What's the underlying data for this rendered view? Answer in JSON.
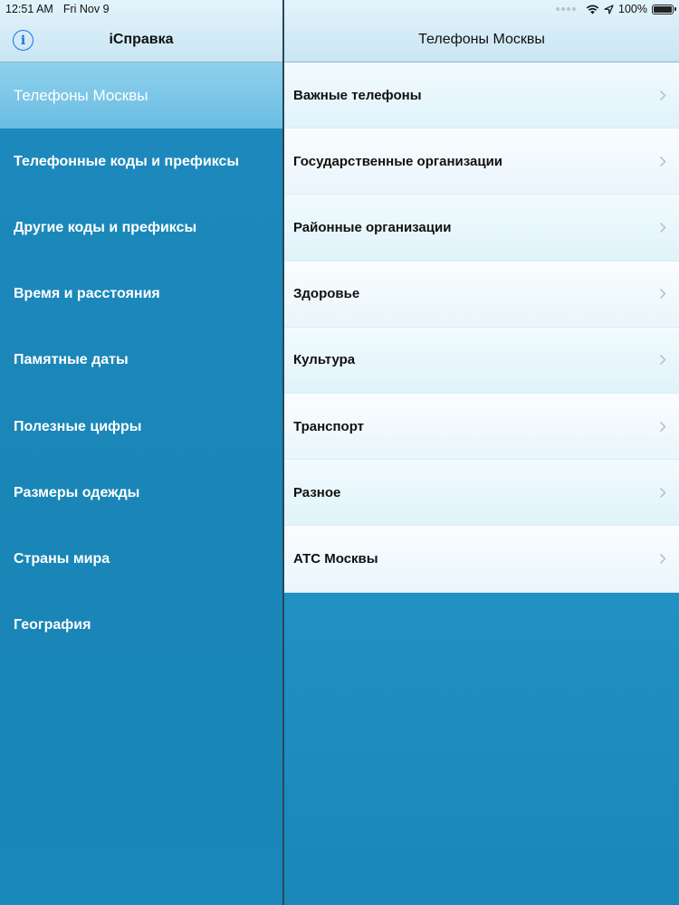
{
  "status": {
    "time": "12:51 AM",
    "date": "Fri Nov 9",
    "battery": "100%",
    "battery_level": 1.0
  },
  "sidebar": {
    "title": "iСправка",
    "items": [
      {
        "label": "Телефоны Москвы",
        "selected": true
      },
      {
        "label": "Телефонные коды и префиксы"
      },
      {
        "label": "Другие коды и префиксы"
      },
      {
        "label": "Время и расстояния"
      },
      {
        "label": "Памятные даты"
      },
      {
        "label": "Полезные цифры"
      },
      {
        "label": "Размеры одежды"
      },
      {
        "label": "Страны мира"
      },
      {
        "label": "География"
      }
    ]
  },
  "detail": {
    "title": "Телефоны Москвы",
    "items": [
      {
        "label": "Важные телефоны"
      },
      {
        "label": "Государственные организации"
      },
      {
        "label": "Районные организации"
      },
      {
        "label": "Здоровье"
      },
      {
        "label": "Культура"
      },
      {
        "label": "Транспорт"
      },
      {
        "label": "Разное"
      },
      {
        "label": "АТС Москвы"
      }
    ]
  },
  "icons": {
    "info": "info-icon",
    "wifi": "wifi-icon",
    "location": "location-arrow-icon",
    "battery": "battery-icon",
    "chevron": "chevron-right-icon"
  },
  "colors": {
    "sidebar_bg": "#1a86b7",
    "selected_row": "#7cc6e8",
    "accent": "#1c6fe8"
  }
}
